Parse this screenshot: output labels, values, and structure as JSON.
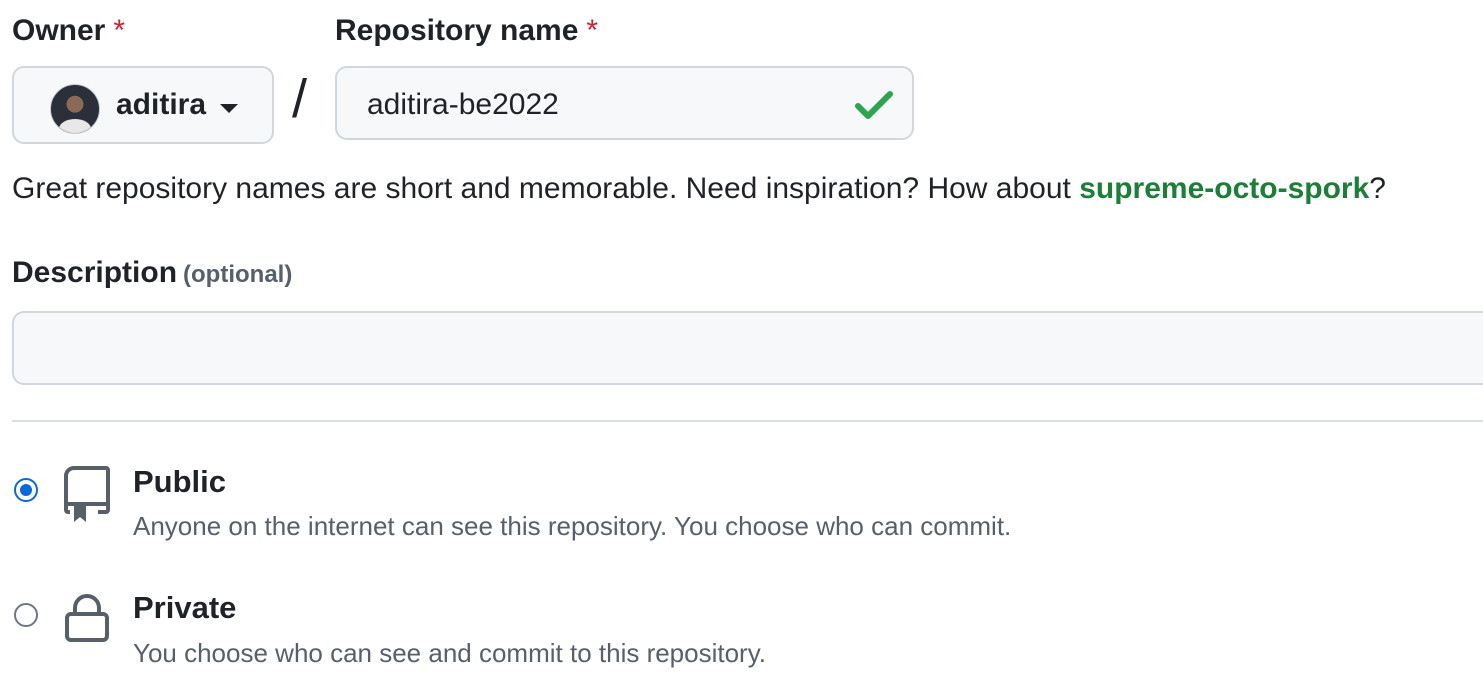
{
  "owner": {
    "label": "Owner",
    "required_mark": "*",
    "username": "aditira",
    "avatar_icon": "user-avatar"
  },
  "separator": "/",
  "repository": {
    "label": "Repository name",
    "required_mark": "*",
    "value": "aditira-be2022",
    "status_icon": "check-icon",
    "status_color": "#2da44e"
  },
  "hint": {
    "text": "Great repository names are short and memorable. Need inspiration? How about ",
    "suggestion": "supreme-octo-spork",
    "suffix": "?"
  },
  "description": {
    "label": "Description",
    "optional_text": "(optional)",
    "value": ""
  },
  "visibility": {
    "options": [
      {
        "title": "Public",
        "description": "Anyone on the internet can see this repository. You choose who can commit.",
        "icon": "repo-icon",
        "selected": true
      },
      {
        "title": "Private",
        "description": "You choose who can see and commit to this repository.",
        "icon": "lock-icon",
        "selected": false
      }
    ]
  },
  "colors": {
    "accent": "#0969da",
    "success": "#1a7f37",
    "required": "#cf222e"
  }
}
